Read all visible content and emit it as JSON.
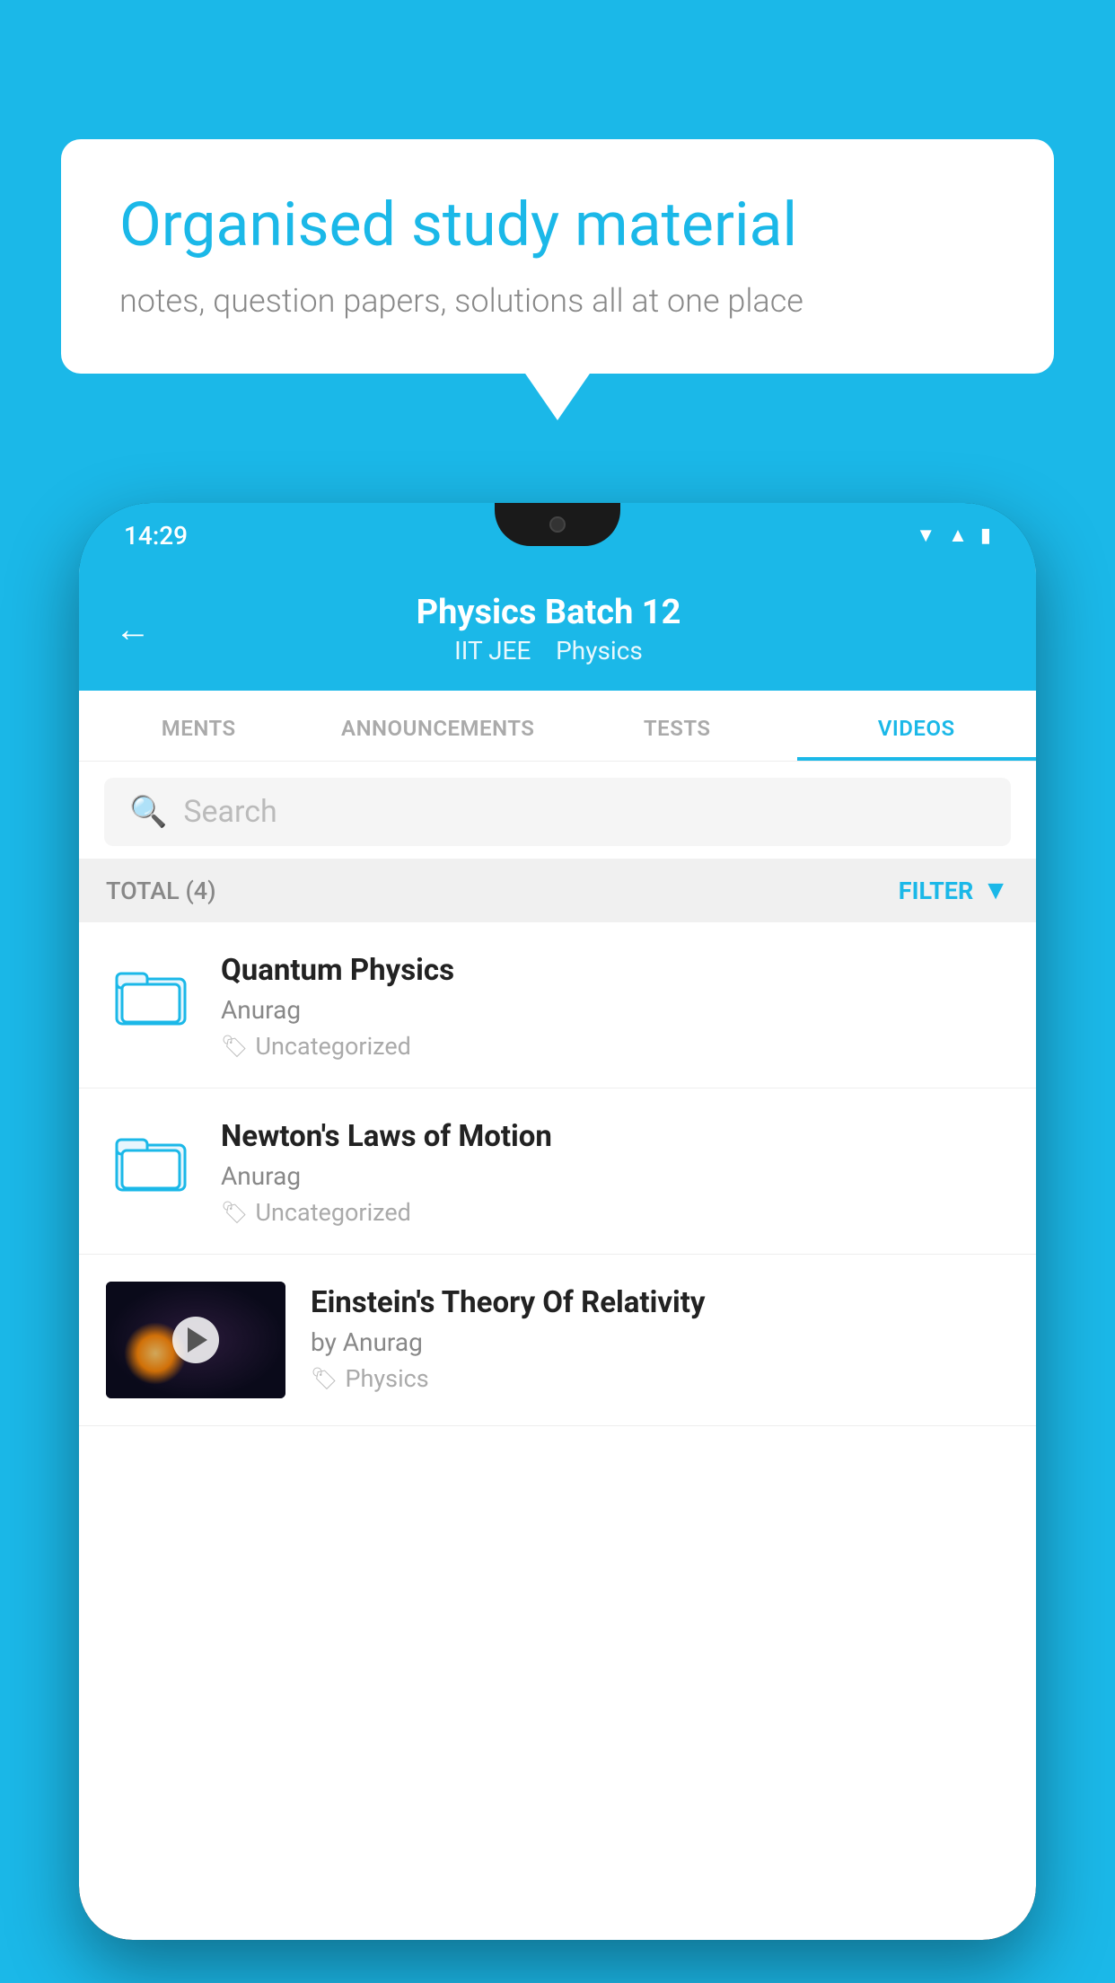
{
  "background_color": "#1bb8e8",
  "speech_bubble": {
    "heading": "Organised study material",
    "subtext": "notes, question papers, solutions all at one place"
  },
  "phone": {
    "status_bar": {
      "time": "14:29"
    },
    "header": {
      "title": "Physics Batch 12",
      "subtitle_tag1": "IIT JEE",
      "subtitle_tag2": "Physics",
      "back_label": "←"
    },
    "tabs": [
      {
        "label": "MENTS",
        "active": false
      },
      {
        "label": "ANNOUNCEMENTS",
        "active": false
      },
      {
        "label": "TESTS",
        "active": false
      },
      {
        "label": "VIDEOS",
        "active": true
      }
    ],
    "search": {
      "placeholder": "Search"
    },
    "filter_bar": {
      "total_label": "TOTAL (4)",
      "filter_label": "FILTER"
    },
    "videos": [
      {
        "id": 1,
        "title": "Quantum Physics",
        "author": "Anurag",
        "tag": "Uncategorized",
        "type": "folder"
      },
      {
        "id": 2,
        "title": "Newton's Laws of Motion",
        "author": "Anurag",
        "tag": "Uncategorized",
        "type": "folder"
      },
      {
        "id": 3,
        "title": "Einstein's Theory Of Relativity",
        "author": "by Anurag",
        "tag": "Physics",
        "type": "video"
      }
    ]
  }
}
